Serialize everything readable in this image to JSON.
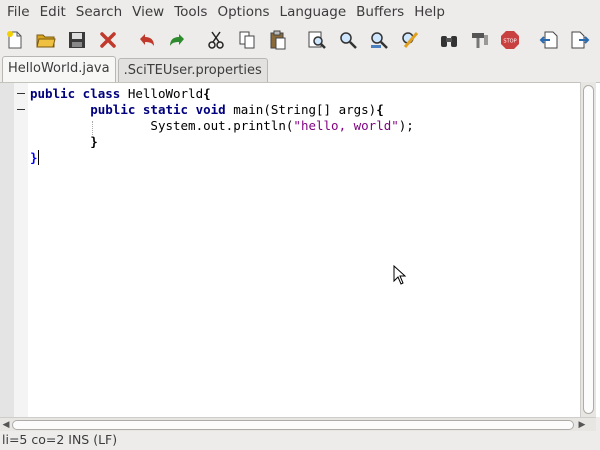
{
  "menubar": {
    "items": [
      {
        "label": "File"
      },
      {
        "label": "Edit"
      },
      {
        "label": "Search"
      },
      {
        "label": "View"
      },
      {
        "label": "Tools"
      },
      {
        "label": "Options"
      },
      {
        "label": "Language"
      },
      {
        "label": "Buffers"
      },
      {
        "label": "Help"
      }
    ]
  },
  "toolbar": {
    "icons": [
      "new-file-icon",
      "open-folder-icon",
      "save-icon",
      "close-icon",
      "undo-icon",
      "redo-icon",
      "cut-icon",
      "copy-icon",
      "paste-icon",
      "find-icon",
      "find-next-icon",
      "find-in-files-icon",
      "replace-icon",
      "binoculars-icon",
      "build-icon",
      "stop-icon",
      "previous-buffer-icon",
      "next-buffer-icon"
    ],
    "colors": {
      "undo": "#c0392b",
      "redo": "#2e8b2e",
      "stop": "#c94040"
    }
  },
  "tabs": [
    {
      "label": "HelloWorld.java",
      "active": true
    },
    {
      "label": ".SciTEUser.properties",
      "active": false
    }
  ],
  "editor": {
    "lines": [
      {
        "kw": "public class",
        "rest": " HelloWorld",
        "brace": "{"
      },
      {
        "indent": "        ",
        "kw": "public static void",
        "rest": " main(String[] args)",
        "brace": "{"
      },
      {
        "indent": "                ",
        "call": "System.out.println(",
        "str": "\"hello, world\"",
        "end": ");"
      },
      {
        "indent": "        ",
        "brace": "}"
      },
      {
        "brace": "}"
      }
    ],
    "colors": {
      "keyword": "#00007f",
      "string": "#7f007f",
      "text": "#000000"
    }
  },
  "statusbar": {
    "text": "li=5 co=2 INS (LF)"
  }
}
